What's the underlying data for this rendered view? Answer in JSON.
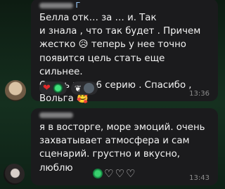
{
  "messages": [
    {
      "author_partial": "Г",
      "text": "Белла отк… за … и. Так\nи знала , что так будет . Причем\nжестко 😥 теперь у нее точно\nпоявится цель стать еще сильнее.\nОчень жду 6 серию . Спасибо ,\nВольга 🥰",
      "time": "13:36",
      "reactions": [
        "red-heart",
        "green-stars",
        "white-wings",
        "user-avatar"
      ]
    },
    {
      "author_partial": "",
      "text": "я в восторге, море эмоций. очень\nзахватывает атмосфера и сам\nсценарий. грустно и вкусно,\nлюблю",
      "time": "13:43",
      "reactions": [
        "emerald",
        "outline-heart",
        "outline-heart",
        "outline-heart"
      ]
    }
  ],
  "colors": {
    "bubble": "#1b1b1d",
    "author": "#9fd0ff",
    "time": "#8c8c8c",
    "reaction_heart": "#e22a2a"
  }
}
